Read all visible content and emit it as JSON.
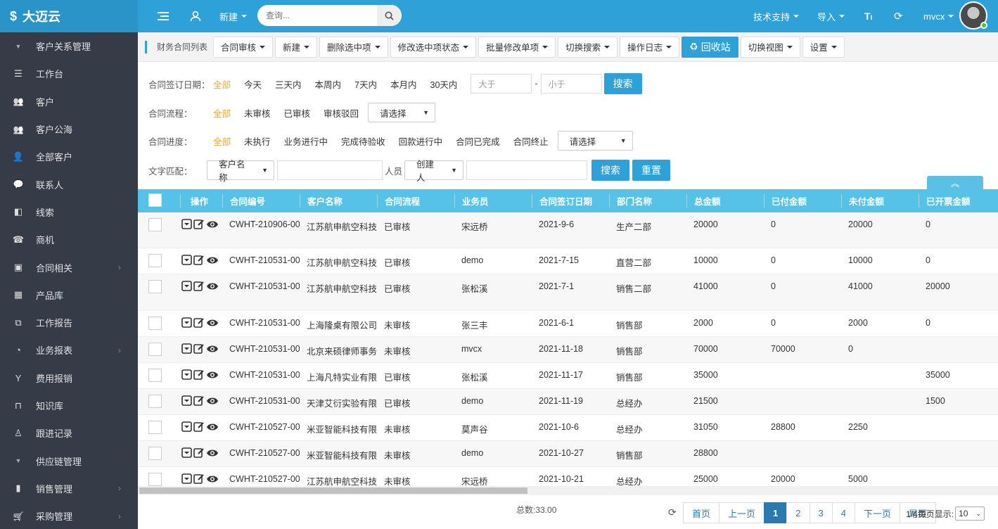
{
  "brand": {
    "name": "大迈云"
  },
  "topbar": {
    "new_label": "新建",
    "search_placeholder": "查询...",
    "tech_support": "技术支持",
    "import": "导入",
    "username": "mvcx"
  },
  "sidebar": {
    "items": [
      {
        "label": "客户关系管理",
        "icon": "caret-down-icon",
        "group": true
      },
      {
        "label": "工作台",
        "icon": "list-icon"
      },
      {
        "label": "客户",
        "icon": "users-icon"
      },
      {
        "label": "客户公海",
        "icon": "users-icon"
      },
      {
        "label": "全部客户",
        "icon": "user-icon"
      },
      {
        "label": "联系人",
        "icon": "chat-icon"
      },
      {
        "label": "线索",
        "icon": "clue-icon"
      },
      {
        "label": "商机",
        "icon": "phone-icon"
      },
      {
        "label": "合同相关",
        "icon": "money-icon",
        "arrow": true
      },
      {
        "label": "产品库",
        "icon": "grid-icon"
      },
      {
        "label": "工作报告",
        "icon": "copy-icon"
      },
      {
        "label": "业务报表",
        "icon": "dashboard-icon",
        "arrow": true
      },
      {
        "label": "费用报销",
        "icon": "yen-icon"
      },
      {
        "label": "知识库",
        "icon": "bookmark-icon"
      },
      {
        "label": "跟进记录",
        "icon": "person-icon"
      },
      {
        "label": "供应链管理",
        "icon": "caret-down-icon",
        "group": true
      },
      {
        "label": "销售管理",
        "icon": "bar-chart-icon",
        "arrow": true
      },
      {
        "label": "采购管理",
        "icon": "cart-icon",
        "arrow": true
      }
    ]
  },
  "toolbar": {
    "crumb": "财务合同列表",
    "buttons": [
      "合同审核",
      "新建",
      "删除选中项",
      "修改选中项状态",
      "批量修改单项",
      "切换搜索",
      "操作日志"
    ],
    "recycle": "回收站",
    "switch_view": "切换视图",
    "settings": "设置"
  },
  "filters": {
    "date": {
      "label": "合同签订日期：",
      "options": [
        "全部",
        "今天",
        "三天内",
        "本周内",
        "7天内",
        "本月内",
        "30天内"
      ],
      "gt_placeholder": "大于",
      "lt_placeholder": "小于",
      "dash": "-",
      "search": "搜索"
    },
    "flow": {
      "label": "合同流程：",
      "options": [
        "全部",
        "未审核",
        "已审核",
        "审核驳回"
      ],
      "select": "请选择"
    },
    "progress": {
      "label": "合同进度：",
      "options": [
        "全部",
        "未执行",
        "业务进行中",
        "完成待验收",
        "回款进行中",
        "合同已完成",
        "合同终止"
      ],
      "select": "请选择"
    },
    "text": {
      "label": "文字匹配：",
      "field": "客户名称",
      "person_label": "人员",
      "person": "创建人",
      "search": "搜索",
      "reset": "重置"
    }
  },
  "table": {
    "headers": [
      "操作",
      "合同编号",
      "客户名称",
      "合同流程",
      "业务员",
      "合同签订日期",
      "部门名称",
      "总金额",
      "已付金额",
      "未付金额",
      "已开票金额"
    ],
    "rows": [
      [
        "CWHT-210906-00",
        "江苏航申航空科技",
        "已审核",
        "宋远桥",
        "2021-9-6",
        "生产二部",
        "20000",
        "0",
        "20000",
        "0"
      ],
      [
        "CWHT-210531-00",
        "江苏航申航空科技",
        "已审核",
        "demo",
        "2021-7-15",
        "直营二部",
        "10000",
        "0",
        "10000",
        "0"
      ],
      [
        "CWHT-210531-00",
        "江苏航申航空科技",
        "已审核",
        "张松溪",
        "2021-7-1",
        "销售二部",
        "41000",
        "0",
        "41000",
        "20000"
      ],
      [
        "CWHT-210531-00",
        "上海隆桌有限公司",
        "未审核",
        "张三丰",
        "2021-6-1",
        "销售部",
        "2000",
        "0",
        "2000",
        "0"
      ],
      [
        "CWHT-210531-00",
        "北京来硕律师事务",
        "未审核",
        "mvcx",
        "2021-11-18",
        "销售部",
        "70000",
        "70000",
        "0",
        ""
      ],
      [
        "CWHT-210531-00",
        "上海凡特实业有限",
        "已审核",
        "张松溪",
        "2021-11-17",
        "销售部",
        "35000",
        "",
        "",
        "35000"
      ],
      [
        "CWHT-210531-00",
        "天津艾衍实验有限",
        "已审核",
        "demo",
        "2021-11-19",
        "总经办",
        "21500",
        "",
        "",
        "1500"
      ],
      [
        "CWHT-210527-00",
        "米亚智能科技有限",
        "未审核",
        "莫声谷",
        "2021-10-6",
        "总经办",
        "31050",
        "28800",
        "2250",
        ""
      ],
      [
        "CWHT-210527-00",
        "米亚智能科技有限",
        "未审核",
        "demo",
        "2021-10-27",
        "销售部",
        "28800",
        "",
        "",
        ""
      ],
      [
        "CWHT-210527-00",
        "江苏航申航空科技",
        "未审核",
        "宋远桥",
        "2021-10-21",
        "总经办",
        "25000",
        "20000",
        "5000",
        ""
      ]
    ]
  },
  "footer": {
    "total": "总数:33.00",
    "first": "首页",
    "prev": "上一页",
    "pages": [
      "1",
      "2",
      "3",
      "4"
    ],
    "next": "下一页",
    "last": "尾页",
    "per_page_label": "1/4每页显示:",
    "per_page": "10"
  }
}
